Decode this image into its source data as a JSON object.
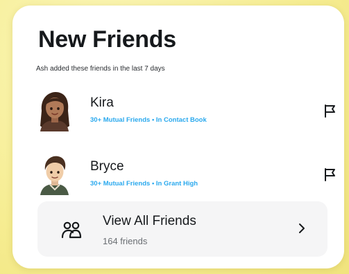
{
  "card": {
    "title": "New Friends",
    "subtitle": "Ash added these friends in the last 7 days"
  },
  "friends": [
    {
      "name": "Kira",
      "meta": "30+ Mutual Friends • In Contact Book",
      "avatar_icon": "bitmoji-avatar-icon",
      "action_icon": "flag-icon"
    },
    {
      "name": "Bryce",
      "meta": "30+ Mutual Friends • In Grant High",
      "avatar_icon": "bitmoji-avatar-icon",
      "action_icon": "flag-icon"
    }
  ],
  "view_all": {
    "label": "View All Friends",
    "count": "164 friends",
    "icon": "people-icon",
    "chevron_icon": "chevron-right-icon"
  },
  "colors": {
    "background": "#f6ed92",
    "card": "#ffffff",
    "title": "#16191c",
    "meta_accent": "#2aa9ee",
    "row_bg": "#f5f5f6",
    "secondary_text": "#6a6e73"
  }
}
